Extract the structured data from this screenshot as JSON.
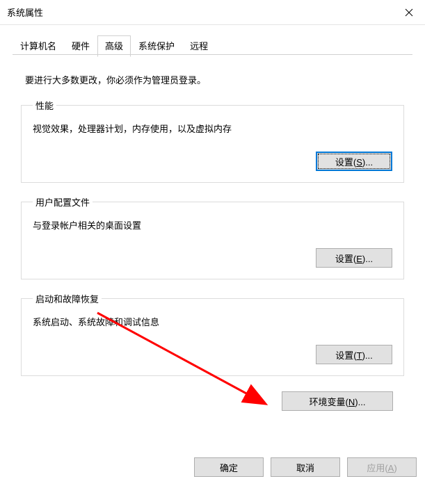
{
  "window": {
    "title": "系统属性"
  },
  "tabs": {
    "computer_name": "计算机名",
    "hardware": "硬件",
    "advanced": "高级",
    "system_protection": "系统保护",
    "remote": "远程"
  },
  "intro": "要进行大多数更改，你必须作为管理员登录。",
  "groups": {
    "performance": {
      "legend": "性能",
      "desc": "视觉效果，处理器计划，内存使用，以及虚拟内存",
      "button_prefix": "设置(",
      "button_key": "S",
      "button_suffix": ")..."
    },
    "profiles": {
      "legend": "用户配置文件",
      "desc": "与登录帐户相关的桌面设置",
      "button_prefix": "设置(",
      "button_key": "E",
      "button_suffix": ")..."
    },
    "startup": {
      "legend": "启动和故障恢复",
      "desc": "系统启动、系统故障和调试信息",
      "button_prefix": "设置(",
      "button_key": "T",
      "button_suffix": ")..."
    }
  },
  "env": {
    "button_prefix": "环境变量(",
    "button_key": "N",
    "button_suffix": ")..."
  },
  "footer": {
    "ok": "确定",
    "cancel": "取消",
    "apply_prefix": "应用(",
    "apply_key": "A",
    "apply_suffix": ")"
  },
  "annotation": {
    "arrow_color": "#ff0000"
  }
}
